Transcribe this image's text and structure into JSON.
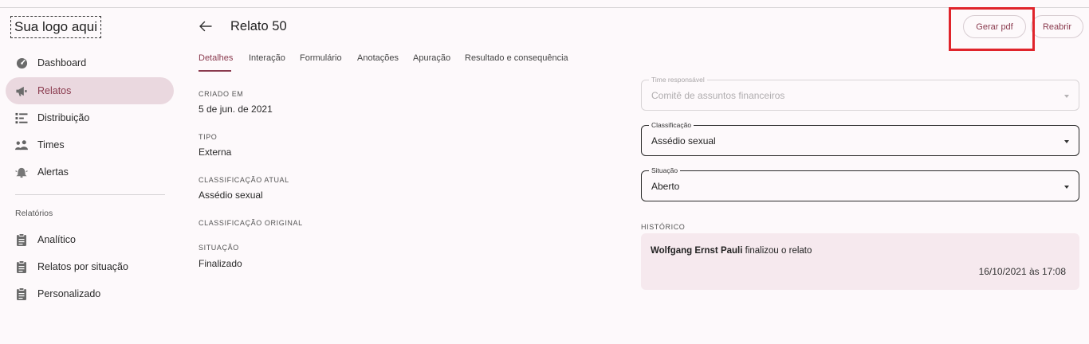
{
  "logo_text": "Sua logo aqui",
  "sidebar": {
    "items": [
      {
        "label": "Dashboard",
        "icon": "dashboard-gauge-icon"
      },
      {
        "label": "Relatos",
        "icon": "megaphone-icon",
        "active": true
      },
      {
        "label": "Distribuição",
        "icon": "distribution-list-icon"
      },
      {
        "label": "Times",
        "icon": "people-group-icon"
      },
      {
        "label": "Alertas",
        "icon": "alert-bell-icon"
      }
    ],
    "section_label": "Relatórios",
    "reports": [
      {
        "label": "Analítico",
        "icon": "clipboard-icon"
      },
      {
        "label": "Relatos por situação",
        "icon": "clipboard-icon"
      },
      {
        "label": "Personalizado",
        "icon": "clipboard-icon"
      }
    ]
  },
  "header": {
    "title": "Relato 50",
    "pdf_button": "Gerar pdf",
    "reopen_button": "Reabrir"
  },
  "tabs": [
    "Detalhes",
    "Interação",
    "Formulário",
    "Anotações",
    "Apuração",
    "Resultado e consequência"
  ],
  "details": {
    "created_label": "CRIADO EM",
    "created_value": "5 de jun. de 2021",
    "type_label": "TIPO",
    "type_value": "Externa",
    "current_class_label": "CLASSIFICAÇÃO ATUAL",
    "current_class_value": "Assédio sexual",
    "original_class_label": "CLASSIFICAÇÃO ORIGINAL",
    "status_label": "SITUAÇÃO",
    "status_value": "Finalizado"
  },
  "form": {
    "team": {
      "label": "Time responsável",
      "value": "Comitê de assuntos financeiros"
    },
    "classification": {
      "label": "Classificação",
      "value": "Assédio sexual"
    },
    "situation": {
      "label": "Situação",
      "value": "Aberto"
    }
  },
  "history": {
    "label": "HISTÓRICO",
    "author": "Wolfgang Ernst Pauli",
    "action": " finalizou o relato",
    "timestamp": "16/10/2021 às 17:08"
  },
  "colors": {
    "accent": "#8a3a4e",
    "active_bg": "#ead8df",
    "card_bg": "#f6e9ee",
    "highlight": "#e0242b"
  }
}
